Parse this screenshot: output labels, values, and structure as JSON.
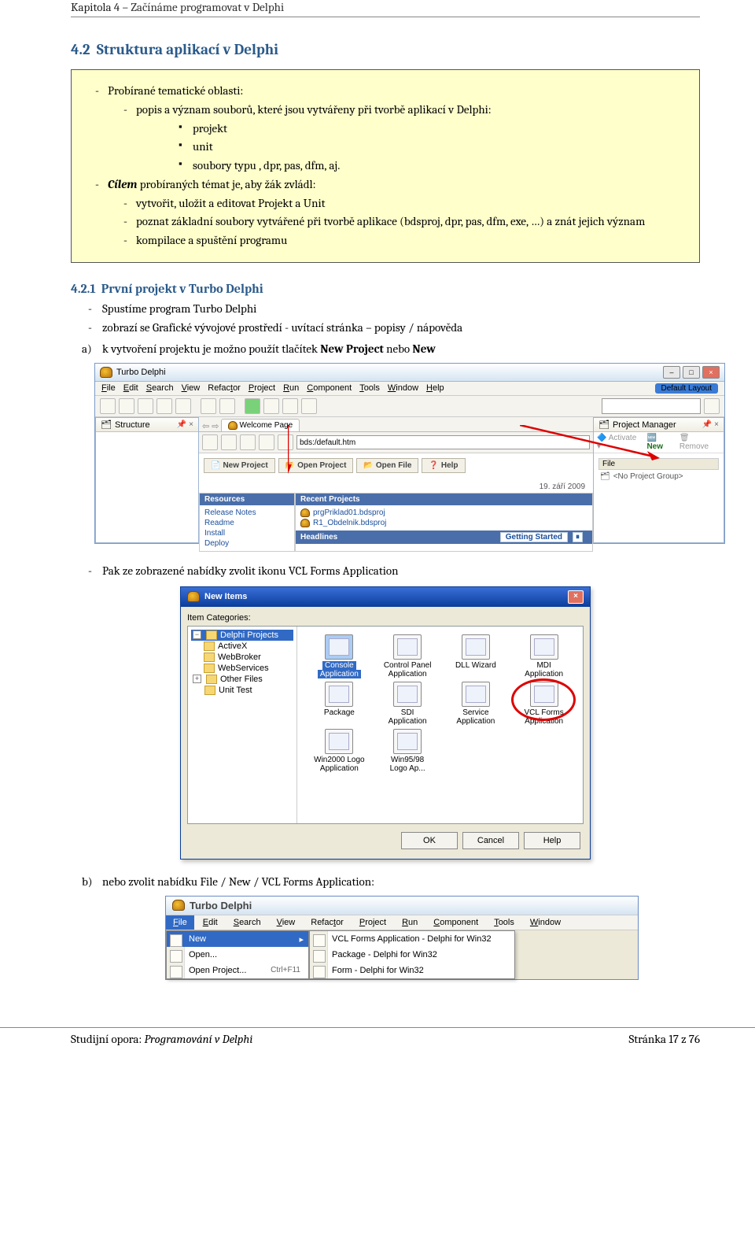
{
  "header": {
    "kapitola": "Kapitola 4",
    "sep": " – ",
    "title": "Začínáme programovat v Delphi"
  },
  "h2": {
    "num": "4.2",
    "title": "Struktura aplikací v Delphi"
  },
  "box": {
    "l1": "Probírané tematické oblasti:",
    "l2": "popis a význam souborů, které jsou vytvářeny při tvorbě aplikací v Delphi:",
    "sq": [
      "projekt",
      "unit",
      "soubory typu , dpr, pas, dfm, aj."
    ],
    "cilem_pre": "Cílem",
    "cilem_rest": " probíraných témat je, aby žák zvládl:",
    "goals": [
      "vytvořit, uložit a editovat Projekt a Unit",
      "poznat základní soubory vytvářené při tvorbě aplikace (bdsproj, dpr, pas, dfm, exe, …) a znát jejich význam",
      "kompilace a spuštění programu"
    ]
  },
  "h3": {
    "num": "4.2.1",
    "title": "První projekt v Turbo Delphi"
  },
  "list1": [
    "Spustíme program Turbo Delphi",
    "zobrazí se Grafické vývojové prostředí - uvítací stránka – popisy / nápověda"
  ],
  "a_line": {
    "pre": "k vytvoření projektu je možno použít tlačítek ",
    "b1": "New Project",
    "mid": " nebo ",
    "b2": "New"
  },
  "ide": {
    "title": "Turbo Delphi",
    "layout": "Default Layout",
    "menus": [
      "File",
      "Edit",
      "Search",
      "View",
      "Refactor",
      "Project",
      "Run",
      "Component",
      "Tools",
      "Window",
      "Help"
    ],
    "structure_title": "Structure",
    "pm_title": "Project Manager",
    "pm_activate": "Activate",
    "pm_new": "New",
    "pm_remove": "Remove",
    "pm_file": "File",
    "pm_group": "<No Project Group>",
    "tab": "Welcome Page",
    "addr": "bds:/default.htm",
    "wbtns": [
      "New Project",
      "Open Project",
      "Open File",
      "Help"
    ],
    "date": "19. září 2009",
    "resources": "Resources",
    "res_items": [
      "Release Notes",
      "Readme",
      "Install",
      "Deploy"
    ],
    "recent": "Recent Projects",
    "recent_items": [
      "prgPriklad01.bdsproj",
      "R1_Obdelnik.bdsproj"
    ],
    "headlines": "Headlines",
    "getting_started": "Getting Started"
  },
  "mid_line": "Pak ze zobrazené nabídky zvolit ikonu VCL Forms Application",
  "dialog": {
    "title": "New Items",
    "label": "Item Categories:",
    "tree_root": "Delphi Projects",
    "tree": [
      "ActiveX",
      "WebBroker",
      "WebServices",
      "Other Files",
      "Unit Test"
    ],
    "items": [
      {
        "l1": "Console",
        "l2": "Application"
      },
      {
        "l1": "Control Panel",
        "l2": "Application"
      },
      {
        "l1": "DLL Wizard",
        "l2": ""
      },
      {
        "l1": "MDI",
        "l2": "Application"
      },
      {
        "l1": "Package",
        "l2": ""
      },
      {
        "l1": "SDI",
        "l2": "Application"
      },
      {
        "l1": "Service",
        "l2": "Application"
      },
      {
        "l1": "VCL Forms",
        "l2": "Application"
      },
      {
        "l1": "Win2000 Logo",
        "l2": "Application"
      },
      {
        "l1": "Win95/98",
        "l2": "Logo Ap..."
      }
    ],
    "btns": [
      "OK",
      "Cancel",
      "Help"
    ]
  },
  "b_line": "nebo zvolit nabídku File / New / VCL Forms Application:",
  "menuimg": {
    "title": "Turbo Delphi",
    "menus": [
      "File",
      "Edit",
      "Search",
      "View",
      "Refactor",
      "Project",
      "Run",
      "Component",
      "Tools",
      "Window"
    ],
    "file": [
      {
        "label": "New",
        "arrow": true,
        "hl": true
      },
      {
        "label": "Open..."
      },
      {
        "label": "Open Project...",
        "sc": "Ctrl+F11"
      }
    ],
    "sub": [
      "VCL Forms Application - Delphi for Win32",
      "Package - Delphi for Win32",
      "Form - Delphi for Win32"
    ]
  },
  "footer": {
    "left_pre": "Studijní opora: ",
    "left_it": "Programování v Delphi",
    "right": "Stránka 17 z 76"
  }
}
